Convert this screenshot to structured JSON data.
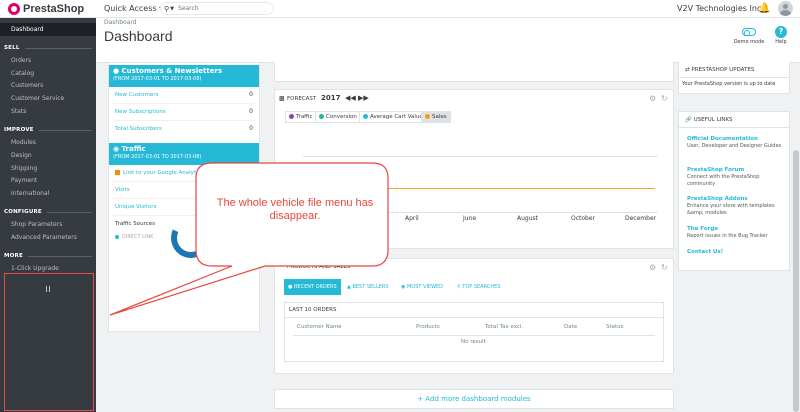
{
  "topbar": {
    "logo_text": "PrestaShop",
    "quick_access": "Quick Access ▾",
    "search_placeholder": "Search",
    "shop_name": "V2V Technologies Inc"
  },
  "header": {
    "breadcrumb": "Dashboard",
    "title": "Dashboard",
    "demo_mode_label": "Demo mode",
    "help_label": "Help"
  },
  "sidebar": {
    "dashboard": "Dashboard",
    "sections": [
      {
        "label": "SELL",
        "items": [
          "Orders",
          "Catalog",
          "Customers",
          "Customer Service",
          "Stats"
        ]
      },
      {
        "label": "IMPROVE",
        "items": [
          "Modules",
          "Design",
          "Shipping",
          "Payment",
          "International"
        ]
      },
      {
        "label": "CONFIGURE",
        "items": [
          "Shop Parameters",
          "Advanced Parameters"
        ]
      },
      {
        "label": "MORE",
        "items": [
          "1-Click Upgrade"
        ]
      }
    ]
  },
  "customers_panel": {
    "title": "Customers & Newsletters",
    "subtitle": "(FROM 2017-03-01 TO 2017-03-08)",
    "rows": [
      {
        "label": "New Customers",
        "value": "0"
      },
      {
        "label": "New Subscriptions",
        "value": "0"
      },
      {
        "label": "Total Subscribers",
        "value": "0"
      }
    ]
  },
  "traffic_panel": {
    "title": "Traffic",
    "subtitle": "(FROM 2017-03-01 TO 2017-03-08)",
    "ga_link": "Link to your Google Analytics",
    "visits": "Visits",
    "unique_visitors": "Unique Visitors",
    "traffic_sources": "Traffic Sources",
    "direct_link": "DIRECT LINK"
  },
  "forecast": {
    "label": "FORECAST",
    "year": "2017",
    "pills": [
      {
        "label": "Traffic",
        "color": "#8e44ad"
      },
      {
        "label": "Conversion",
        "color": "#1abc9c"
      },
      {
        "label": "Average Cart Value",
        "color": "#25b9d7"
      },
      {
        "label": "Sales",
        "color": "#f39c12"
      }
    ],
    "months": [
      "April",
      "June",
      "August",
      "October",
      "December"
    ],
    "line_color": "#f5a623"
  },
  "products_panel": {
    "title": "PRODUCTS AND SALES",
    "tabs": [
      "RECENT ORDERS",
      "BEST SELLERS",
      "MOST VIEWED",
      "TOP SEARCHES"
    ],
    "section_title": "LAST 10 ORDERS",
    "columns": [
      "Customer Name",
      "Products",
      "Total Tax excl.",
      "Date",
      "Status"
    ],
    "empty": "No result"
  },
  "updates": {
    "title": "PRESTASHOP UPDATES",
    "message": "Your PrestaShop version is up to date"
  },
  "useful_links": {
    "title": "USEFUL LINKS",
    "links": [
      {
        "label": "Official Documentation",
        "desc": "User, Developer and Designer Guides"
      },
      {
        "label": "PrestaShop Forum",
        "desc": "Connect with the PrestaShop community"
      },
      {
        "label": "PrestaShop Addons",
        "desc": "Enhance your store with templates &amp; modules"
      },
      {
        "label": "The Forge",
        "desc": "Report issues in the Bug Tracker"
      },
      {
        "label": "Contact Us!",
        "desc": ""
      }
    ]
  },
  "callout": {
    "text": "The whole vehicle file menu has disappear."
  },
  "add_modules": "+ Add more dashboard modules",
  "colors": {
    "sidebar_bg": "#363a41",
    "accent": "#25b9d7",
    "annotation": "#e84a4a"
  }
}
